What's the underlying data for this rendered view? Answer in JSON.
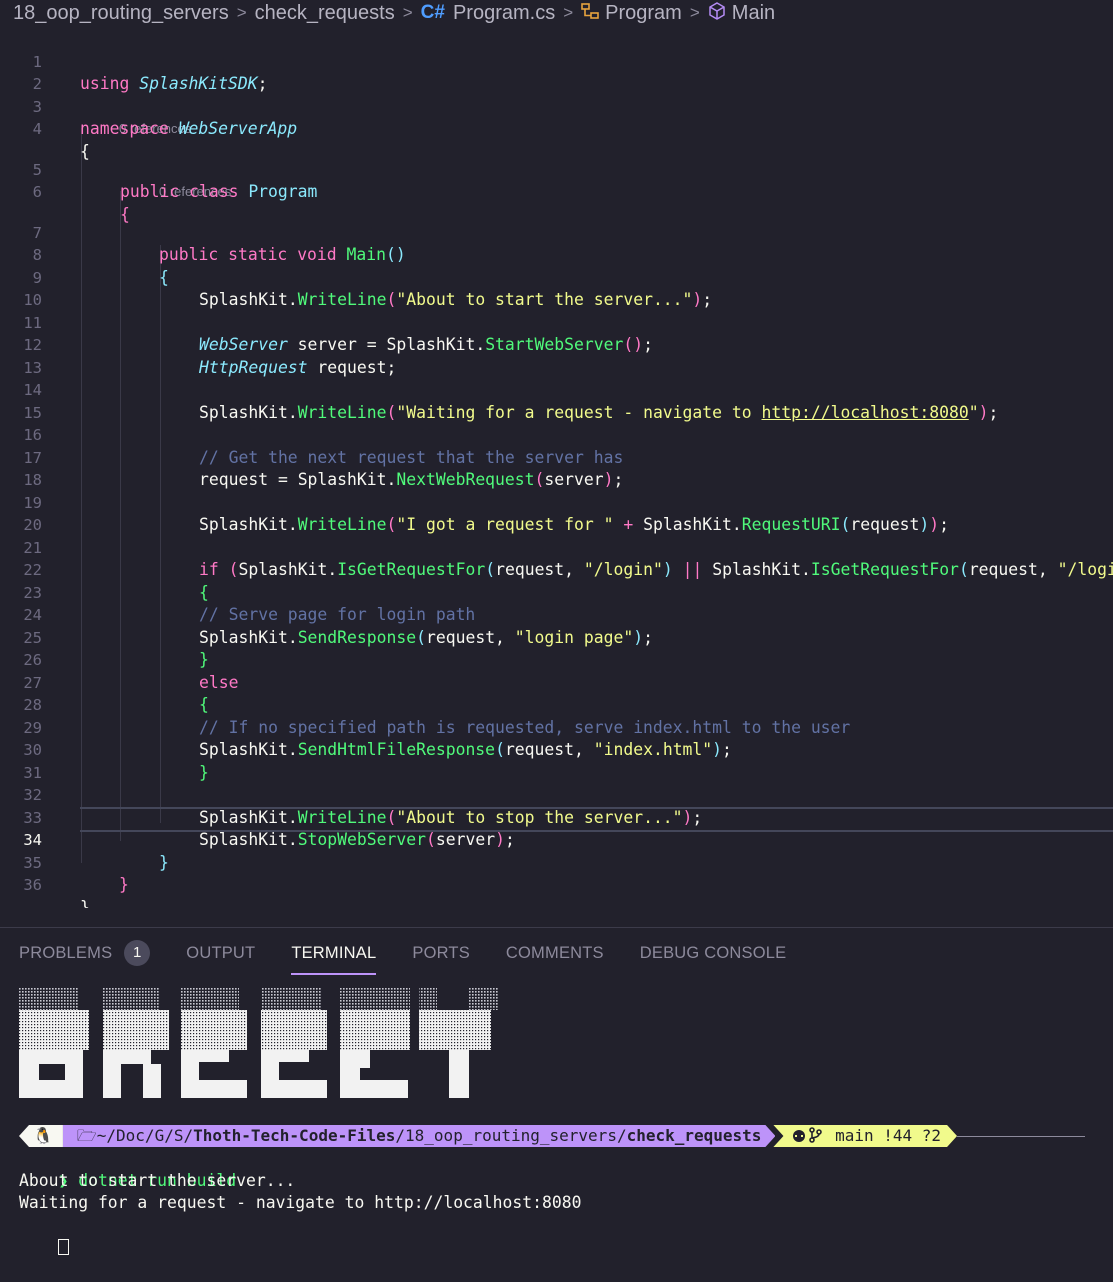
{
  "breadcrumb": {
    "items": [
      "18_oop_routing_servers",
      "check_requests",
      "Program.cs",
      "Program",
      "Main"
    ],
    "cs_glyph": "C#"
  },
  "editor": {
    "lens_text": "0 references",
    "lines": [
      {
        "n": "1"
      },
      {
        "n": "2"
      },
      {
        "n": "3"
      },
      {
        "n": "4"
      },
      {
        "n": "5"
      },
      {
        "n": "6"
      },
      {
        "n": "7"
      },
      {
        "n": "8"
      },
      {
        "n": "9"
      },
      {
        "n": "10"
      },
      {
        "n": "11"
      },
      {
        "n": "12"
      },
      {
        "n": "13"
      },
      {
        "n": "14"
      },
      {
        "n": "15"
      },
      {
        "n": "16"
      },
      {
        "n": "17"
      },
      {
        "n": "18"
      },
      {
        "n": "19"
      },
      {
        "n": "20"
      },
      {
        "n": "21"
      },
      {
        "n": "22"
      },
      {
        "n": "23"
      },
      {
        "n": "24"
      },
      {
        "n": "25"
      },
      {
        "n": "26"
      },
      {
        "n": "27"
      },
      {
        "n": "28"
      },
      {
        "n": "29"
      },
      {
        "n": "30"
      },
      {
        "n": "31"
      },
      {
        "n": "32"
      },
      {
        "n": "33"
      },
      {
        "n": "34"
      },
      {
        "n": "35"
      },
      {
        "n": "36"
      }
    ],
    "code": {
      "l1": [
        "using",
        "SplashKitSDK",
        ";"
      ],
      "l3": [
        "namespace",
        "WebServerApp"
      ],
      "l4": "{",
      "l5": [
        "public",
        "class",
        "Program"
      ],
      "l6": "{",
      "l7": [
        "public",
        "static",
        "void",
        "Main",
        "(",
        ")"
      ],
      "l8": "{",
      "l9": [
        "SplashKit",
        ".",
        "WriteLine",
        "(",
        "\"About to start the server...\"",
        ")",
        ";"
      ],
      "l11": [
        "WebServer",
        " server = ",
        "SplashKit",
        ".",
        "StartWebServer",
        "(",
        ")",
        ";"
      ],
      "l12": [
        "HttpRequest",
        " request;"
      ],
      "l14": [
        "SplashKit",
        ".",
        "WriteLine",
        "(",
        "\"Waiting for a request - navigate to ",
        "http://localhost:8080",
        "\"",
        ")",
        ";"
      ],
      "l16": "// Get the next request that the server has",
      "l17": [
        "request = ",
        "SplashKit",
        ".",
        "NextWebRequest",
        "(",
        "server",
        ")",
        ";"
      ],
      "l19": [
        "SplashKit",
        ".",
        "WriteLine",
        "(",
        "\"I got a request for \"",
        " + ",
        "SplashKit",
        ".",
        "RequestURI",
        "(",
        "request",
        ")",
        ")",
        ";"
      ],
      "l21": [
        "if",
        " (",
        "SplashKit",
        ".",
        "IsGetRequestFor",
        "(",
        "request, ",
        "\"/login\"",
        ")",
        " || ",
        "SplashKit",
        ".",
        "IsGetRequestFor",
        "(",
        "request, ",
        "\"/login/\"",
        ")",
        ")"
      ],
      "l22": "{",
      "l23": "// Serve page for login path",
      "l24": [
        "SplashKit",
        ".",
        "SendResponse",
        "(",
        "request, ",
        "\"login page\"",
        ")",
        ";"
      ],
      "l25": "}",
      "l26": "else",
      "l27": "{",
      "l28": "// If no specified path is requested, serve index.html to the user",
      "l29": [
        "SplashKit",
        ".",
        "SendHtmlFileResponse",
        "(",
        "request, ",
        "\"index.html\"",
        ")",
        ";"
      ],
      "l30": "}",
      "l32": [
        "SplashKit",
        ".",
        "WriteLine",
        "(",
        "\"About to stop the server...\"",
        ")",
        ";"
      ],
      "l33": [
        "SplashKit",
        ".",
        "StopWebServer",
        "(",
        "server",
        ")",
        ";"
      ],
      "l34": "}",
      "l35": "}",
      "l36": "}"
    }
  },
  "panel": {
    "tabs": [
      "PROBLEMS",
      "OUTPUT",
      "TERMINAL",
      "PORTS",
      "COMMENTS",
      "DEBUG CONSOLE"
    ],
    "problems_count": "1",
    "active_tab": "TERMINAL"
  },
  "terminal": {
    "prompt": {
      "os_icon": "🐧",
      "folder_icon": "🗁",
      "path_prefix": "~/Doc/G/S/",
      "path_repo": "Thoth-Tech-Code-Files",
      "path_mid": "/18_oop_routing_servers/",
      "path_leaf": "check_requests",
      "git_icon": "",
      "git_text": "main !44 ?2"
    },
    "command_chevron": "❯",
    "command": "dotnet run build",
    "output": [
      "About to start the server...",
      "Waiting for a request - navigate to http://localhost:8080"
    ]
  },
  "colors": {
    "background": "#22212c",
    "keyword": "#ff79c6",
    "type": "#8be9fd",
    "function": "#50fa7b",
    "string": "#f1fa8c",
    "comment": "#6272a4",
    "accent": "#bd93f9"
  }
}
